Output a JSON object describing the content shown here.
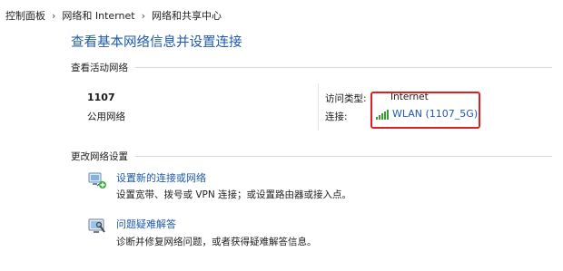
{
  "breadcrumb": {
    "items": [
      "控制面板",
      "网络和 Internet",
      "网络和共享中心"
    ],
    "separator": "›"
  },
  "page_title": "查看基本网络信息并设置连接",
  "active_networks": {
    "header": "查看活动网络",
    "network_name": "1107",
    "network_type": "公用网络",
    "access_type_label": "访问类型:",
    "access_type_value": "Internet",
    "connection_label": "连接:",
    "connection_value": "WLAN (1107_5G)"
  },
  "change_settings": {
    "header": "更改网络设置",
    "tasks": [
      {
        "link": "设置新的连接或网络",
        "description": "设置宽带、拨号或 VPN 连接；或设置路由器或接入点。",
        "icon": "new-connection-icon"
      },
      {
        "link": "问题疑难解答",
        "description": "诊断并修复网络问题，或者获得疑难解答信息。",
        "icon": "troubleshoot-icon"
      }
    ]
  },
  "colors": {
    "link": "#1e5aa8",
    "highlight_border": "#e02020",
    "signal": "#3a9d2f"
  }
}
